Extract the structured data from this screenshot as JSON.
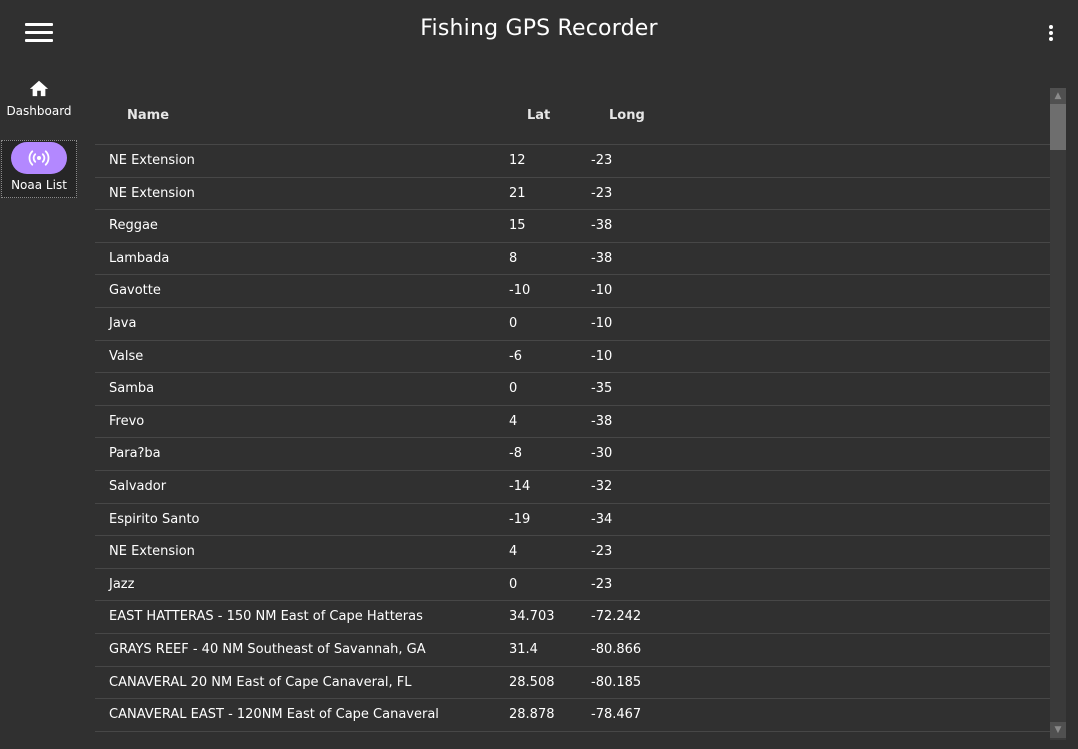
{
  "app": {
    "title": "Fishing GPS Recorder"
  },
  "toolbar": {
    "menu_icon": "hamburger-menu-icon",
    "more_icon": "more-vert-icon"
  },
  "nav": {
    "items": [
      {
        "label": "Dashboard",
        "icon": "home-icon",
        "active": false
      },
      {
        "label": "Noaa List",
        "icon": "broadcast-icon",
        "active": true,
        "accent": "#b388ff"
      }
    ]
  },
  "table": {
    "columns": [
      "Name",
      "Lat",
      "Long"
    ],
    "rows": [
      {
        "name": "NE Extension",
        "lat": "12",
        "long": "-23"
      },
      {
        "name": "NE Extension",
        "lat": "21",
        "long": "-23"
      },
      {
        "name": "Reggae",
        "lat": "15",
        "long": "-38"
      },
      {
        "name": "Lambada",
        "lat": "8",
        "long": "-38"
      },
      {
        "name": "Gavotte",
        "lat": "-10",
        "long": "-10"
      },
      {
        "name": "Java",
        "lat": "0",
        "long": "-10"
      },
      {
        "name": "Valse",
        "lat": "-6",
        "long": "-10"
      },
      {
        "name": "Samba",
        "lat": "0",
        "long": "-35"
      },
      {
        "name": "Frevo",
        "lat": "4",
        "long": "-38"
      },
      {
        "name": "Para?ba",
        "lat": "-8",
        "long": "-30"
      },
      {
        "name": "Salvador",
        "lat": "-14",
        "long": "-32"
      },
      {
        "name": "Espirito Santo",
        "lat": "-19",
        "long": "-34"
      },
      {
        "name": "NE Extension",
        "lat": "4",
        "long": "-23"
      },
      {
        "name": "Jazz",
        "lat": "0",
        "long": "-23"
      },
      {
        "name": "EAST HATTERAS - 150 NM East of Cape Hatteras",
        "lat": "34.703",
        "long": "-72.242"
      },
      {
        "name": "GRAYS REEF - 40 NM Southeast of Savannah, GA",
        "lat": "31.4",
        "long": "-80.866"
      },
      {
        "name": "CANAVERAL 20 NM East of Cape Canaveral, FL",
        "lat": "28.508",
        "long": "-80.185"
      },
      {
        "name": "CANAVERAL EAST - 120NM East of Cape Canaveral",
        "lat": "28.878",
        "long": "-78.467"
      }
    ]
  },
  "colors": {
    "background": "#303030",
    "accent": "#b388ff",
    "divider": "#474747"
  }
}
